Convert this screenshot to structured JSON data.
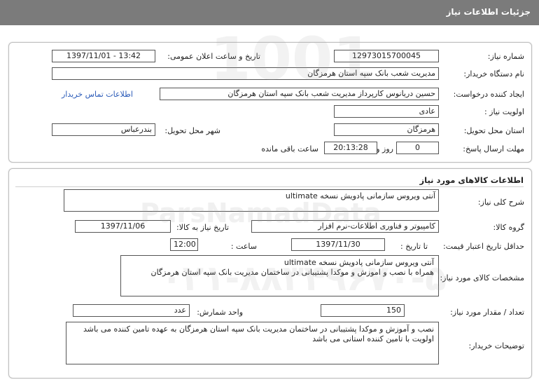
{
  "header": {
    "title": "جزئیات اطلاعات نیاز"
  },
  "need_info": {
    "need_number_label": "شماره نیاز:",
    "need_number": "12973015700045",
    "announce_label": "تاریخ و ساعت اعلان عمومی:",
    "announce_value": "1397/11/01 - 13:42",
    "buyer_org_label": "نام دستگاه خریدار:",
    "buyer_org": "مدیریت شعب بانک سپه استان هرمزگان",
    "requester_label": "ایجاد کننده درخواست:",
    "requester": "حسین دریانوس کارپرداز مدیریت شعب بانک سپه استان هرمزگان",
    "contact_link": "اطلاعات تماس خریدار",
    "priority_label": "اولویت نیاز :",
    "priority": "عادی",
    "province_label": "استان محل تحویل:",
    "province": "هرمزگان",
    "city_label": "شهر محل تحویل:",
    "city": "بندرعباس",
    "deadline_label": "مهلت ارسال پاسخ:",
    "days": "0",
    "days_label": "روز و",
    "time_left": "20:13:28",
    "time_left_label": "ساعت باقی مانده"
  },
  "goods": {
    "section_title": "اطلاعات کالاهای مورد نیاز",
    "general_desc_label": "شرح کلی نیاز:",
    "general_desc": "آنتی ویروس سازمانی پادویش نسخه ultimate",
    "group_label": "گروه کالا:",
    "group": "کامپیوتر و فناوری اطلاعات-نرم افزار",
    "need_date_label": "تاریخ نیاز به کالا:",
    "need_date": "1397/11/06",
    "validity_label": "حداقل تاریخ اعتبار قیمت:",
    "until_label": "تا تاریخ :",
    "validity_date": "1397/11/30",
    "time_label": "ساعت :",
    "validity_time": "12:00",
    "specs_label": "مشخصات کالای مورد نیاز:",
    "specs_lines": [
      "آنتی ویروس سازمانی پادویش نسخه  ultimate",
      "همراه با نصب و اموزش و موکدا پشتیبانی در ساختمان مدیریت بانک سپه استان هرمزگان"
    ],
    "qty_label": "تعداد / مقدار مورد نیاز:",
    "qty": "150",
    "unit_label": "واحد شمارش:",
    "unit": "عدد",
    "buyer_notes_label": "توضیحات خریدار:",
    "buyer_notes_lines": [
      "نصب و آموزش و موکدا پشتیبانی در ساختمان مدیریت بانک سپه استان هرمزگان به عهده تامین کننده می باشد",
      "اولویت با تامین کننده استانی می باشد"
    ]
  },
  "watermark": {
    "numbers": "1001",
    "brand": "ParsNamadData",
    "phone": "۰۲۱-۸۸۳۴۹۶۷۰-۵"
  }
}
